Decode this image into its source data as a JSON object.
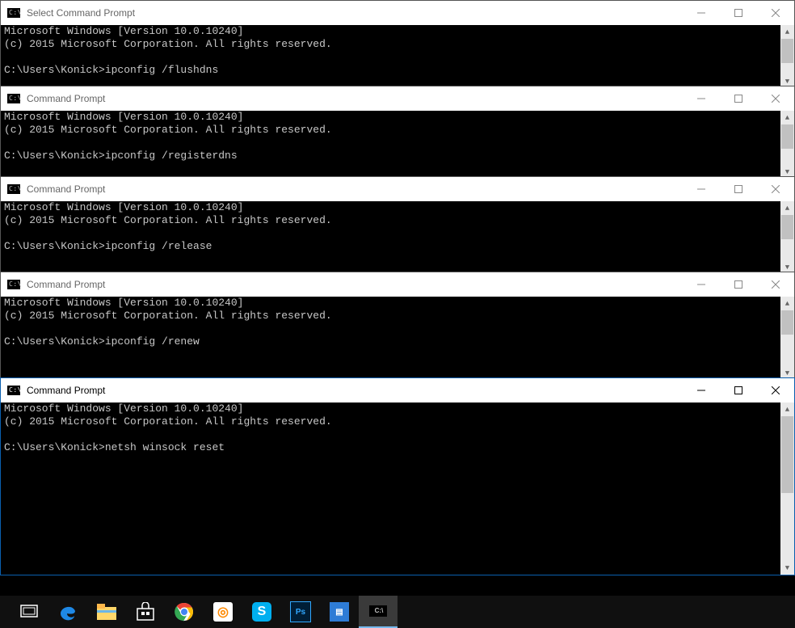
{
  "windows": [
    {
      "title": "Select Command Prompt",
      "active": false,
      "lines": [
        "Microsoft Windows [Version 10.0.10240]",
        "(c) 2015 Microsoft Corporation. All rights reserved.",
        "",
        "C:\\Users\\Konick>ipconfig /flushdns"
      ]
    },
    {
      "title": "Command Prompt",
      "active": false,
      "lines": [
        "Microsoft Windows [Version 10.0.10240]",
        "(c) 2015 Microsoft Corporation. All rights reserved.",
        "",
        "C:\\Users\\Konick>ipconfig /registerdns"
      ]
    },
    {
      "title": "Command Prompt",
      "active": false,
      "lines": [
        "Microsoft Windows [Version 10.0.10240]",
        "(c) 2015 Microsoft Corporation. All rights reserved.",
        "",
        "C:\\Users\\Konick>ipconfig /release"
      ]
    },
    {
      "title": "Command Prompt",
      "active": false,
      "lines": [
        "Microsoft Windows [Version 10.0.10240]",
        "(c) 2015 Microsoft Corporation. All rights reserved.",
        "",
        "C:\\Users\\Konick>ipconfig /renew"
      ]
    },
    {
      "title": "Command Prompt",
      "active": true,
      "lines": [
        "Microsoft Windows [Version 10.0.10240]",
        "(c) 2015 Microsoft Corporation. All rights reserved.",
        "",
        "C:\\Users\\Konick>netsh winsock reset"
      ]
    }
  ],
  "taskbar": {
    "items": [
      {
        "name": "task-view-icon"
      },
      {
        "name": "edge-icon"
      },
      {
        "name": "file-explorer-icon"
      },
      {
        "name": "store-icon"
      },
      {
        "name": "chrome-icon"
      },
      {
        "name": "app-icon-1"
      },
      {
        "name": "skype-icon"
      },
      {
        "name": "photoshop-icon"
      },
      {
        "name": "app-icon-2"
      },
      {
        "name": "command-prompt-icon"
      }
    ]
  }
}
